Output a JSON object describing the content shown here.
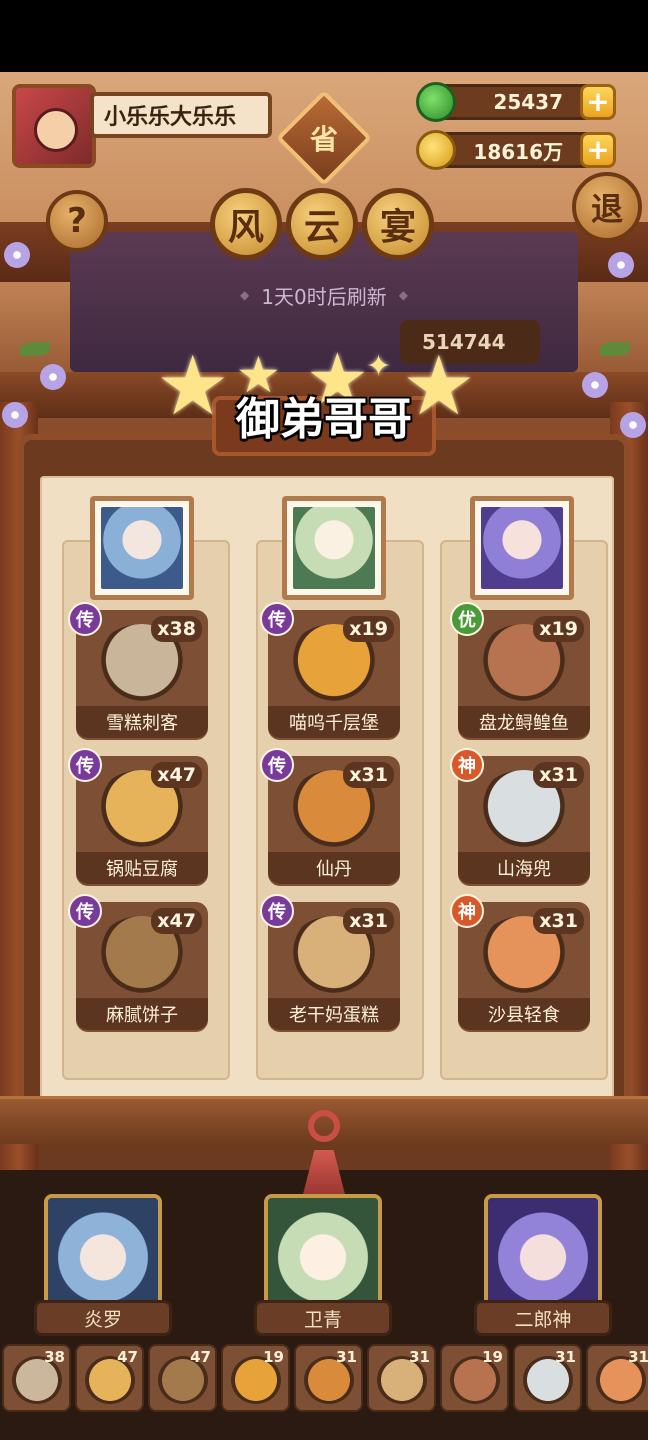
{
  "player": {
    "name": "小乐乐大乐乐"
  },
  "resources": {
    "jade": "25437",
    "coins": "18616万"
  },
  "province_label": "省",
  "title_chars": [
    "风",
    "云",
    "宴"
  ],
  "help_label": "?",
  "exit_label": "退",
  "refresh_text": "1天0时后刷新",
  "score_text": "514744",
  "header_name": "御弟哥哥",
  "columns": [
    {
      "dishes": [
        {
          "name": "雪糕刺客",
          "count": "x38",
          "badge": "传",
          "tier": "chuan",
          "color": "#c9b59a"
        },
        {
          "name": "锅贴豆腐",
          "count": "x47",
          "badge": "传",
          "tier": "chuan",
          "color": "#e6b25a"
        },
        {
          "name": "麻腻饼子",
          "count": "x47",
          "badge": "传",
          "tier": "chuan",
          "color": "#a37a4b"
        }
      ]
    },
    {
      "dishes": [
        {
          "name": "喵呜千层堡",
          "count": "x19",
          "badge": "传",
          "tier": "chuan",
          "color": "#e8a23a"
        },
        {
          "name": "仙丹",
          "count": "x31",
          "badge": "传",
          "tier": "chuan",
          "color": "#d98a3a"
        },
        {
          "name": "老干妈蛋糕",
          "count": "x31",
          "badge": "传",
          "tier": "chuan",
          "color": "#d7b07a"
        }
      ]
    },
    {
      "dishes": [
        {
          "name": "盘龙鲟鳇鱼",
          "count": "x19",
          "badge": "优",
          "tier": "you",
          "color": "#b7734f"
        },
        {
          "name": "山海兜",
          "count": "x31",
          "badge": "神",
          "tier": "shen",
          "color": "#d9dfe0"
        },
        {
          "name": "沙县轻食",
          "count": "x31",
          "badge": "神",
          "tier": "shen",
          "color": "#e5935a"
        }
      ]
    }
  ],
  "heroes": [
    "炎罗",
    "卫青",
    "二郎神"
  ],
  "inventory": [
    {
      "count": "38",
      "color": "#cbb79c"
    },
    {
      "count": "47",
      "color": "#e6b25a"
    },
    {
      "count": "47",
      "color": "#a37a4b"
    },
    {
      "count": "19",
      "color": "#e8a23a"
    },
    {
      "count": "31",
      "color": "#d98a3a"
    },
    {
      "count": "31",
      "color": "#d7b07a"
    },
    {
      "count": "19",
      "color": "#b7734f"
    },
    {
      "count": "31",
      "color": "#d9dfe0"
    },
    {
      "count": "31",
      "color": "#e5935a"
    }
  ]
}
